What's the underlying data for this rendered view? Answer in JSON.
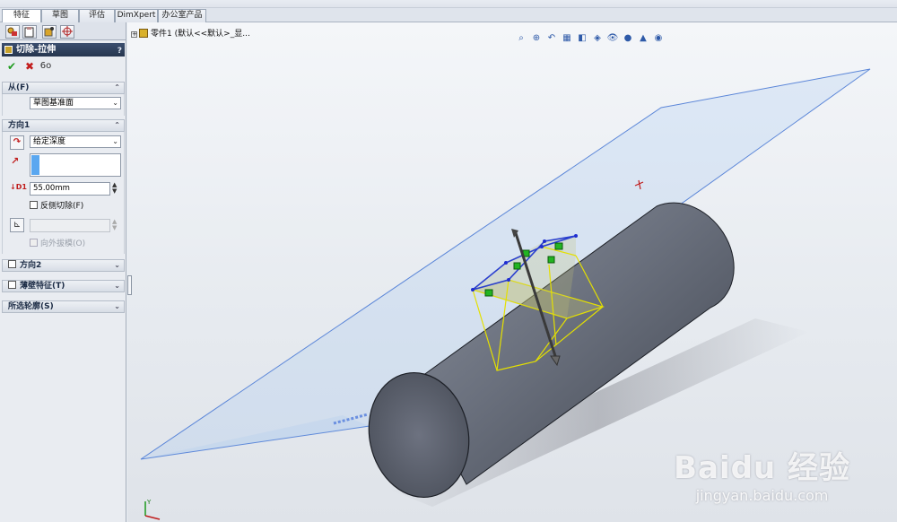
{
  "top_strip": {
    "items": [
      "",
      "",
      "",
      ""
    ]
  },
  "command_tabs": [
    "特征",
    "草图",
    "评估",
    "DimXpert",
    "办公室产品"
  ],
  "manager_tabs": [
    "feature-manager-tab",
    "property-manager-tab",
    "configuration-manager-tab",
    "dimxpert-manager-tab"
  ],
  "property_manager": {
    "title": "切除-拉伸",
    "help": "?",
    "ok": "✔",
    "cancel": "✖",
    "preview": "6o"
  },
  "from_group": {
    "label": "从(F)",
    "start_condition": "草图基准面"
  },
  "direction1": {
    "label": "方向1",
    "end_condition": "给定深度",
    "depth": "55.00mm",
    "flip_side": "反侧切除(F)",
    "draft_outward": "向外拔模(O)"
  },
  "direction2": {
    "label": "方向2"
  },
  "thin_feature": {
    "label": "薄壁特征(T)"
  },
  "selected_contours": {
    "label": "所选轮廓(S)"
  },
  "tree": {
    "text": "零件1 (默认<<默认>_显..."
  },
  "watermark": {
    "brand": "Baidu 经验",
    "url": "jingyan.baidu.com"
  },
  "colors": {
    "plane_edge": "#5b86d8",
    "sketch_yellow": "#e4e000",
    "body_fill": "#5c6270"
  }
}
